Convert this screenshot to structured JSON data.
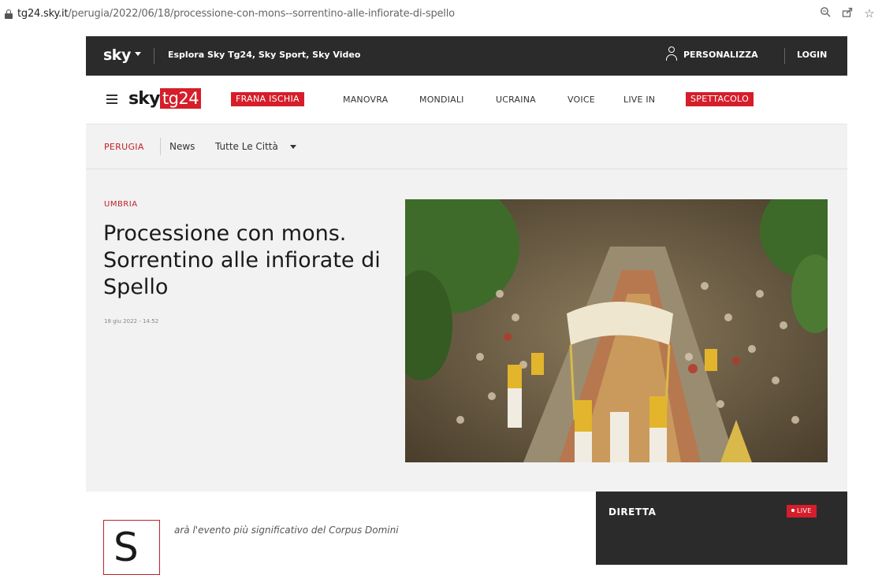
{
  "browser": {
    "url_host": "tg24.sky.it",
    "url_path": "/perugia/2022/06/18/processione-con-mons--sorrentino-alle-infiorate-di-spello",
    "icons": [
      "lock-icon",
      "zoom-icon",
      "share-icon",
      "bookmark-star-icon"
    ]
  },
  "topbar": {
    "brand": "sky",
    "explore": "Esplora Sky Tg24, Sky Sport, Sky Video",
    "personalize": "PERSONALIZZA",
    "login": "LOGIN"
  },
  "nav": {
    "logo_sky": "sky",
    "logo_tg": "tg24",
    "items": [
      {
        "label": "FRANA ISCHIA",
        "highlight": true
      },
      {
        "label": "MANOVRA",
        "highlight": false
      },
      {
        "label": "MONDIALI",
        "highlight": false
      },
      {
        "label": "UCRAINA",
        "highlight": false
      },
      {
        "label": "VOICE",
        "highlight": false
      },
      {
        "label": "LIVE IN",
        "highlight": false
      },
      {
        "label": "SPETTACOLO",
        "highlight": true
      }
    ]
  },
  "subnav": {
    "city": "PERUGIA",
    "news": "News",
    "all_cities": "Tutte Le Città"
  },
  "article": {
    "kicker": "UMBRIA",
    "title": "Processione con mons. Sorrentino alle infiorate di Spello",
    "date": "18 giu 2022 - 14:52",
    "drop_cap": "S",
    "lead": "arà l'evento più significativo del Corpus Domini"
  },
  "sidebar": {
    "label": "DIRETTA",
    "live_badge": "LIVE"
  },
  "colors": {
    "accent_red": "#d51e2a",
    "dark_bar": "#2b2b2b",
    "page_bg": "#f2f2f2"
  }
}
